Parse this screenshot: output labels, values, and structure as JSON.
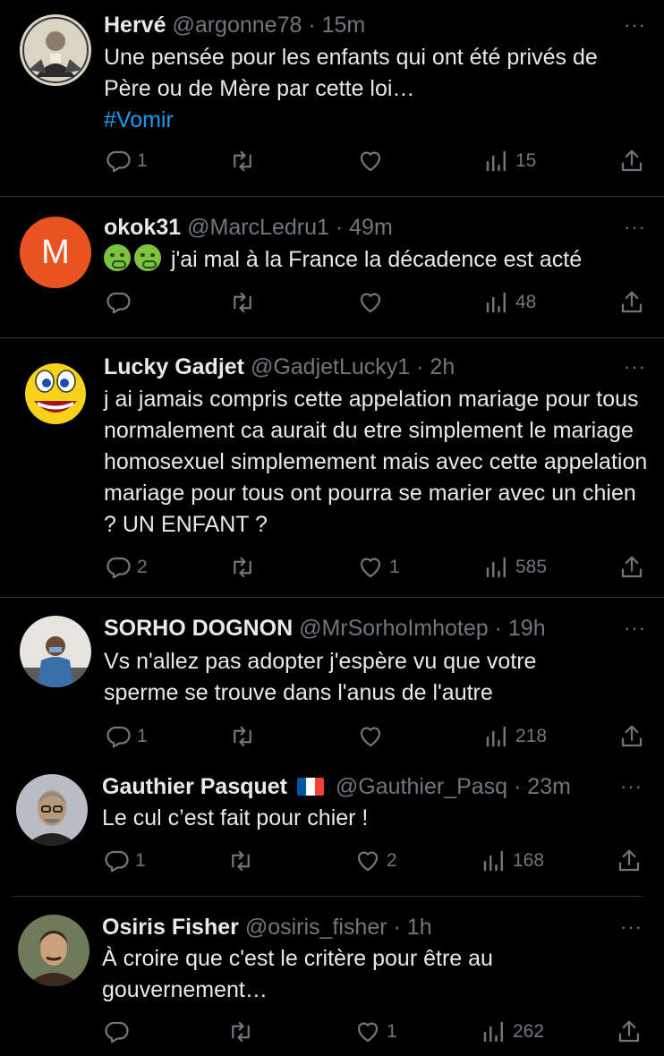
{
  "icons": {
    "reply": "reply-icon",
    "retweet": "retweet-icon",
    "like": "heart-icon",
    "views": "views-icon",
    "share": "share-icon",
    "more": "more-icon"
  },
  "colors": {
    "background": "#000000",
    "text": "#e7e9ea",
    "muted": "#71767b",
    "link": "#1d9bf0",
    "divider": "#2f3336"
  },
  "tweets": [
    {
      "name": "Hervé",
      "handle": "@argonne78",
      "time": "· 15m",
      "text": "Une pensée pour les enfants qui ont été privés de Père ou de Mère par cette loi…",
      "hashtag": "#Vomir",
      "replies": "1",
      "retweets": "",
      "likes": "",
      "views": "15"
    },
    {
      "name": "okok31",
      "handle": "@MarcLedru1",
      "time": "· 49m",
      "avatar_letter": "M",
      "text": "j'ai mal à la France la décadence est acté",
      "replies": "",
      "retweets": "",
      "likes": "",
      "views": "48"
    },
    {
      "name": "Lucky Gadjet",
      "handle": "@GadjetLucky1",
      "time": "· 2h",
      "text": "j ai jamais compris cette appelation mariage pour tous  normalement ca aurait du etre simplement le mariage homosexuel  simplemement mais avec cette appelation mariage pour tous ont pourra se marier avec un chien ? UN ENFANT ?",
      "replies": "2",
      "retweets": "",
      "likes": "1",
      "views": "585"
    },
    {
      "name": "SORHO DOGNON",
      "handle": "@MrSorhoImhotep",
      "time": "· 19h",
      "text": "Vs n'allez pas adopter j'espère vu que votre sperme se trouve dans l'anus de l'autre",
      "replies": "1",
      "retweets": "",
      "likes": "",
      "views": "218"
    },
    {
      "name": "Gauthier Pasquet",
      "handle": "@Gauthier_Pasq",
      "time": "· 23m",
      "text": "Le cul c’est fait pour chier !",
      "replies": "1",
      "retweets": "",
      "likes": "2",
      "views": "168"
    },
    {
      "name": "Osiris Fisher",
      "handle": "@osiris_fisher",
      "time": "· 1h",
      "text": "À croire que c'est le critère pour être au gouvernement…",
      "replies": "",
      "retweets": "",
      "likes": "1",
      "views": "262"
    }
  ]
}
